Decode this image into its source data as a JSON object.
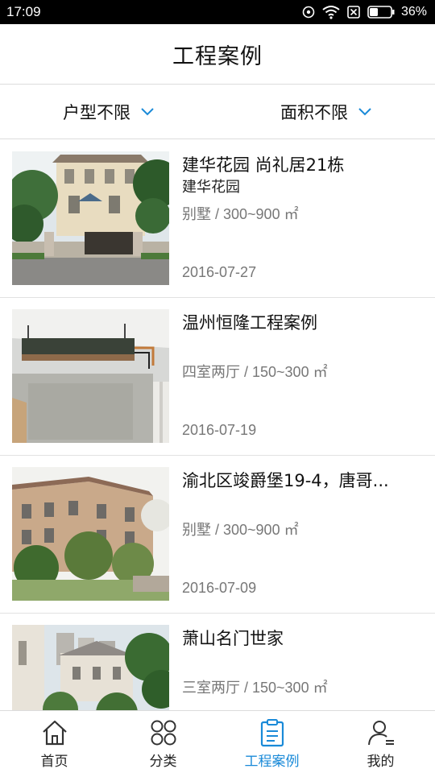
{
  "status_bar": {
    "time": "17:09",
    "battery": "36%"
  },
  "header": {
    "title": "工程案例"
  },
  "filters": [
    {
      "label": "户型不限"
    },
    {
      "label": "面积不限"
    }
  ],
  "cases": [
    {
      "name": "建华花园 尚礼居21栋",
      "subtitle": "建华花园",
      "spec": "别墅 / 300~900 ㎡",
      "date": "2016-07-27"
    },
    {
      "name": "温州恒隆工程案例",
      "subtitle": "",
      "spec": "四室两厅 / 150~300 ㎡",
      "date": "2016-07-19"
    },
    {
      "name": "渝北区竣爵堡19-4，唐哥...",
      "subtitle": "",
      "spec": "别墅 / 300~900 ㎡",
      "date": "2016-07-09"
    },
    {
      "name": "萧山名门世家",
      "subtitle": "",
      "spec": "三室两厅 / 150~300 ㎡",
      "date": ""
    }
  ],
  "bottom_nav": [
    {
      "label": "首页",
      "icon": "home-icon",
      "active": false
    },
    {
      "label": "分类",
      "icon": "category-icon",
      "active": false
    },
    {
      "label": "工程案例",
      "icon": "clipboard-icon",
      "active": true
    },
    {
      "label": "我的",
      "icon": "profile-icon",
      "active": false
    }
  ],
  "colors": {
    "accent": "#1a8ad8",
    "text": "#111111",
    "muted": "#777777",
    "divider": "#dcdcdc"
  }
}
